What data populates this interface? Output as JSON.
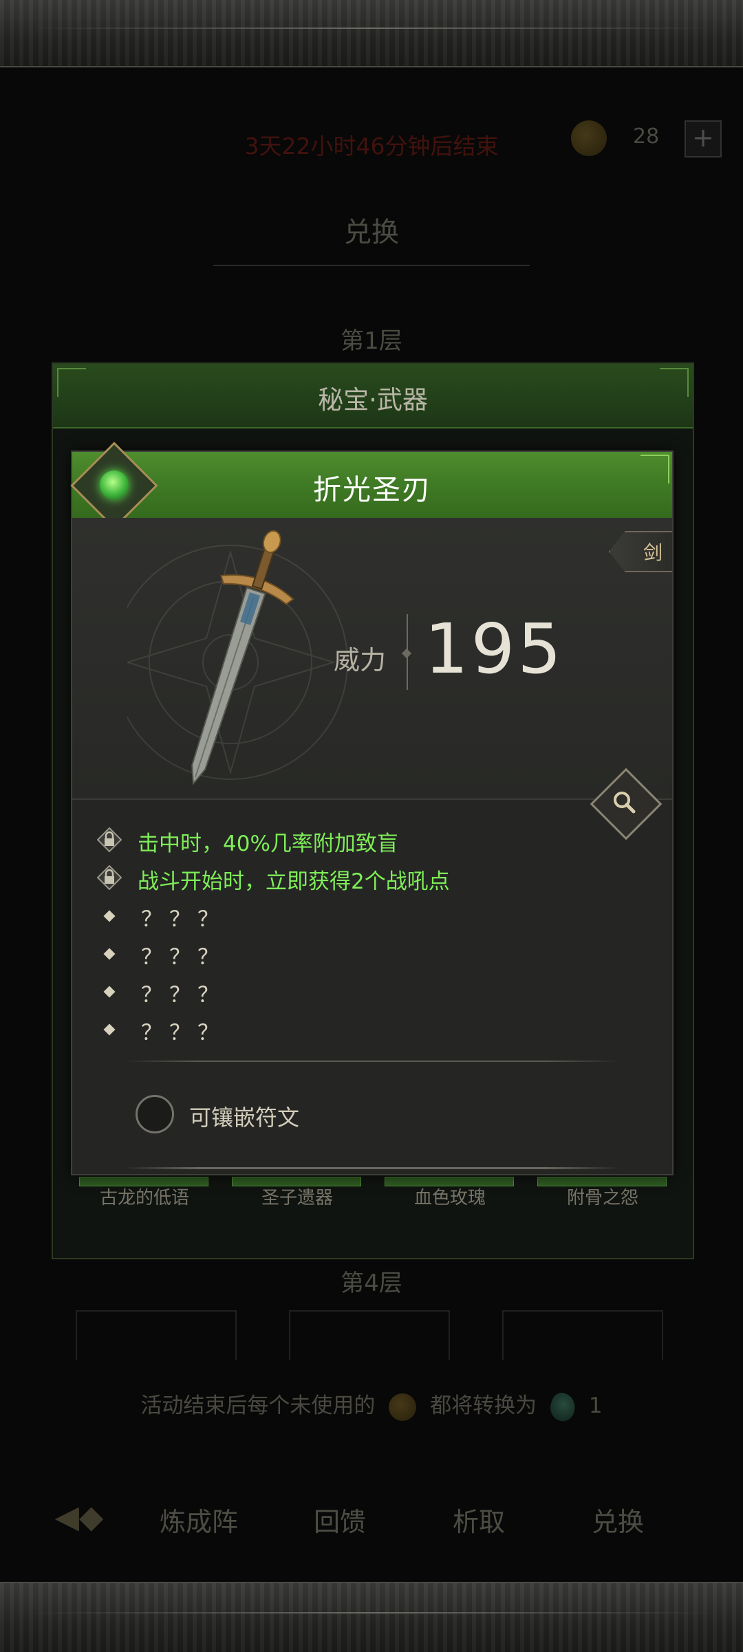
{
  "background": {
    "timer": "3天22小时46分钟后结束",
    "currency_count": "28",
    "plus_label": "+",
    "exchange_title": "兑换",
    "layer_1": "第1层",
    "layer_4": "第4层",
    "note_before": "活动结束后每个未使用的",
    "note_after": "都将转换为",
    "note_count": "1",
    "nav_back": "◀◆",
    "nav_tabs": [
      "炼成阵",
      "回馈",
      "析取",
      "兑换"
    ],
    "outer_item_labels": [
      "古龙的低语",
      "圣子遗器",
      "血色玫瑰",
      "附骨之怨"
    ]
  },
  "outer_panel": {
    "title": "秘宝·武器"
  },
  "item": {
    "name": "折光圣刃",
    "type": "剑",
    "power_label": "威力",
    "power_value": "195",
    "effects_unlocked": [
      "击中时，40%几率附加致盲",
      "战斗开始时，立即获得2个战吼点"
    ],
    "effects_locked": [
      "？？？",
      "？？？",
      "？？？",
      "？？？"
    ],
    "rune_label": "可镶嵌符文"
  },
  "colors": {
    "header_green": "#3f7a24",
    "effect_green": "#7fee58",
    "timer_red": "#c0281f",
    "card_bg": "#252624"
  },
  "icons": {
    "emblem": "green-gem-emblem-icon",
    "zoom": "magnifier-icon",
    "lock": "lock-icon",
    "coin": "coin-icon",
    "gem": "gem-icon"
  }
}
